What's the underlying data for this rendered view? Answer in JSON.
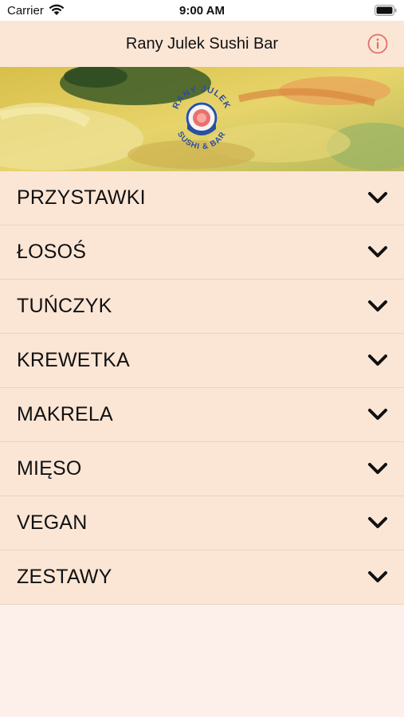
{
  "status_bar": {
    "carrier": "Carrier",
    "time": "9:00 AM"
  },
  "nav": {
    "title": "Rany Julek Sushi Bar",
    "info_icon": "info-icon",
    "info_color": "#e0706b"
  },
  "banner": {
    "logo_text_top": "RANY JULEK",
    "logo_text_bottom": "SUSHI & BAR"
  },
  "menu": {
    "items": [
      {
        "label": "PRZYSTAWKI"
      },
      {
        "label": "ŁOSOŚ"
      },
      {
        "label": "TUŃCZYK"
      },
      {
        "label": "KREWETKA"
      },
      {
        "label": "MAKRELA"
      },
      {
        "label": "MIĘSO"
      },
      {
        "label": "VEGAN"
      },
      {
        "label": "ZESTAWY"
      }
    ],
    "chevron_icon": "chevron-down-icon"
  },
  "colors": {
    "row_background": "#fbe6d6",
    "page_background": "#fdf0ea",
    "logo_blue": "#2b4fa0"
  }
}
